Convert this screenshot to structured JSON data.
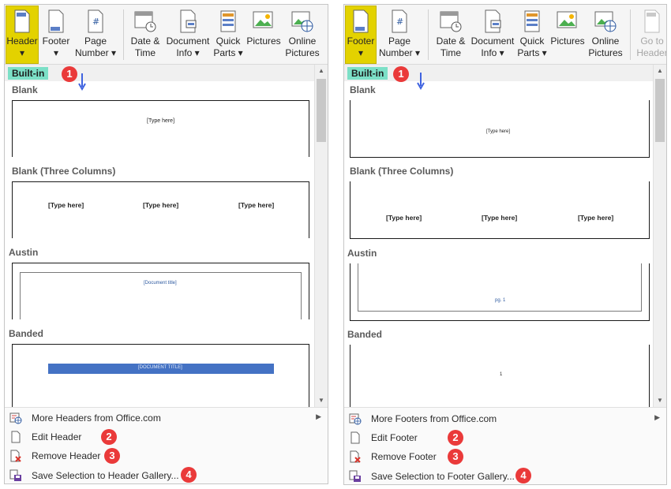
{
  "left": {
    "ribbon": [
      {
        "line1": "Header",
        "line2": "",
        "caret": "▾",
        "icon": "header-icon",
        "active": true
      },
      {
        "line1": "Footer",
        "line2": "",
        "caret": "▾",
        "icon": "footer-icon",
        "active": false
      },
      {
        "line1": "Page",
        "line2": "Number ▾",
        "caret": "",
        "icon": "page-number-icon",
        "active": false
      },
      {
        "line1": "Date &",
        "line2": "Time",
        "caret": "",
        "icon": "date-time-icon",
        "active": false
      },
      {
        "line1": "Document",
        "line2": "Info ▾",
        "caret": "",
        "icon": "document-info-icon",
        "active": false
      },
      {
        "line1": "Quick",
        "line2": "Parts ▾",
        "caret": "",
        "icon": "quick-parts-icon",
        "active": false
      },
      {
        "line1": "Pictures",
        "line2": "",
        "caret": "",
        "icon": "pictures-icon",
        "active": false
      },
      {
        "line1": "Online",
        "line2": "Pictures",
        "caret": "",
        "icon": "online-pictures-icon",
        "active": false
      }
    ],
    "builtin_label": "Built-in",
    "badge_1": "1",
    "categories": {
      "blank": "Blank",
      "three_columns": "Blank (Three Columns)",
      "austin": "Austin",
      "banded": "Banded"
    },
    "thumb_text": {
      "blank": "[Type here]",
      "col1": "[Type here]",
      "col2": "[Type here]",
      "col3": "[Type here]",
      "austin": "[Document title]",
      "banded": "[DOCUMENT TITLE]"
    },
    "menu": {
      "more": "More Headers from Office.com",
      "edit": "Edit Header",
      "remove": "Remove Header",
      "save": "Save Selection to Header Gallery...",
      "badge_2": "2",
      "badge_3": "3",
      "badge_4": "4"
    }
  },
  "right": {
    "ribbon": [
      {
        "line1": "Footer",
        "line2": "",
        "caret": "▾",
        "icon": "footer-icon",
        "active": true
      },
      {
        "line1": "Page",
        "line2": "Number ▾",
        "caret": "",
        "icon": "page-number-icon",
        "active": false
      },
      {
        "line1": "Date &",
        "line2": "Time",
        "caret": "",
        "icon": "date-time-icon",
        "active": false
      },
      {
        "line1": "Document",
        "line2": "Info ▾",
        "caret": "",
        "icon": "document-info-icon",
        "active": false
      },
      {
        "line1": "Quick",
        "line2": "Parts ▾",
        "caret": "",
        "icon": "quick-parts-icon",
        "active": false
      },
      {
        "line1": "Pictures",
        "line2": "",
        "caret": "",
        "icon": "pictures-icon",
        "active": false
      },
      {
        "line1": "Online",
        "line2": "Pictures",
        "caret": "",
        "icon": "online-pictures-icon",
        "active": false
      },
      {
        "line1": "Go to",
        "line2": "Header",
        "caret": "",
        "icon": "go-to-header-icon",
        "active": false
      }
    ],
    "builtin_label": "Built-in",
    "badge_1": "1",
    "categories": {
      "blank": "Blank",
      "three_columns": "Blank (Three Columns)",
      "austin": "Austin",
      "banded": "Banded"
    },
    "thumb_text": {
      "blank": "[Type here]",
      "col1": "[Type here]",
      "col2": "[Type here]",
      "col3": "[Type here]",
      "austin": "pg. 1",
      "banded": "1"
    },
    "menu": {
      "more": "More Footers from Office.com",
      "edit": "Edit Footer",
      "remove": "Remove Footer",
      "save": "Save Selection to Footer Gallery...",
      "badge_2": "2",
      "badge_3": "3",
      "badge_4": "4"
    }
  },
  "colors": {
    "active_button": "#e3d200",
    "builtin_tag": "#7ce0c7",
    "badge": "#ea3a3a",
    "arrow": "#3f63e0",
    "banded_bar": "#4472c4"
  }
}
